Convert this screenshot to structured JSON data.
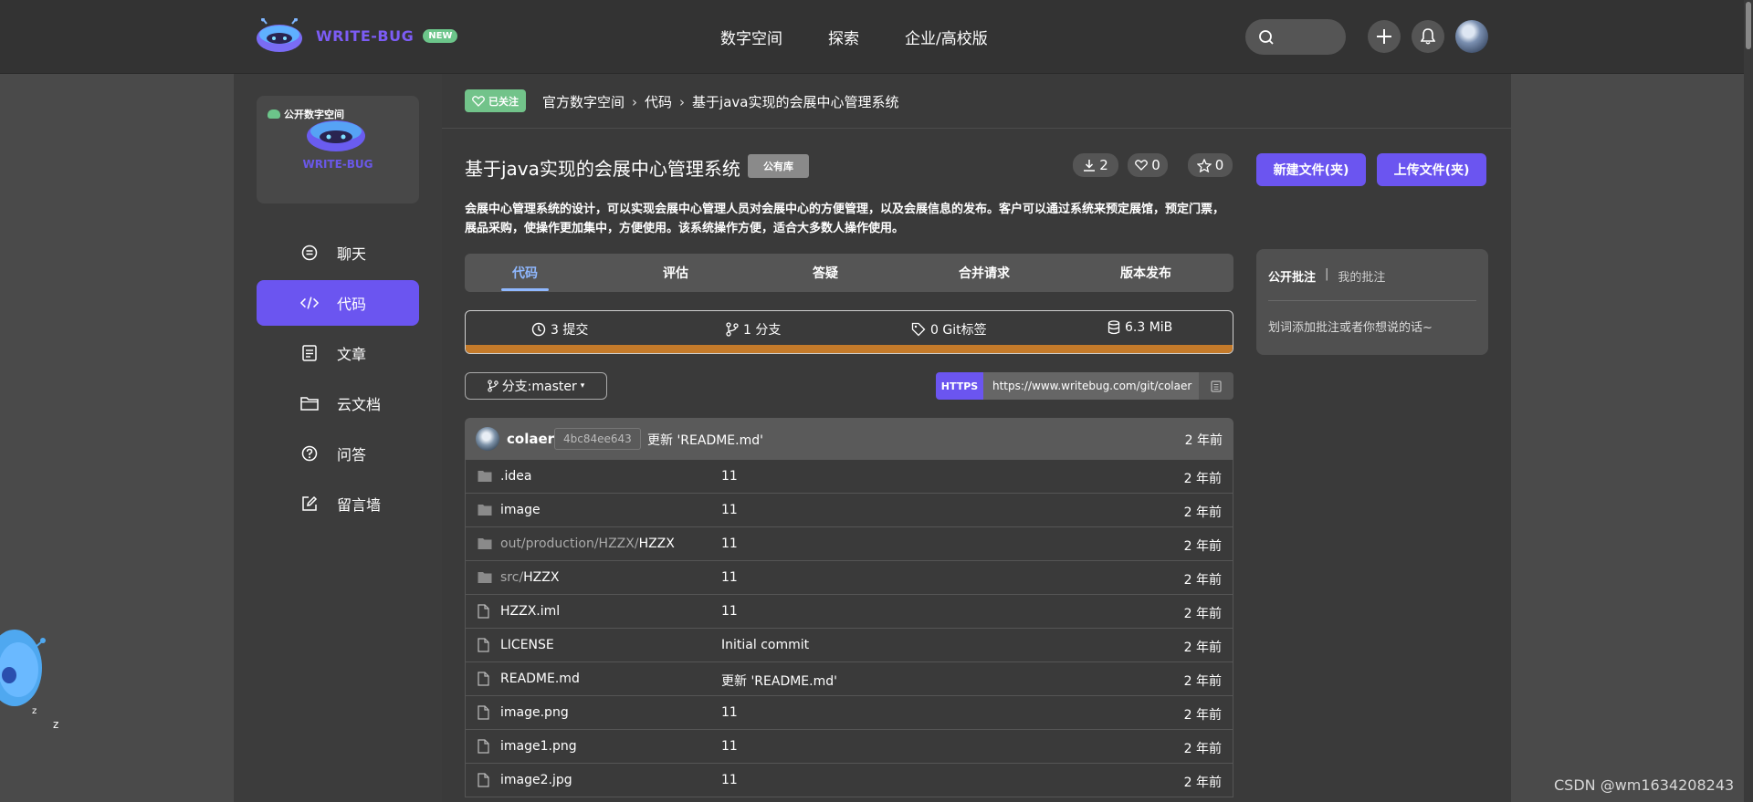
{
  "header": {
    "brand": "WRITE-BUG",
    "new_badge": "NEW",
    "nav": [
      "数字空间",
      "探索",
      "企业/高校版"
    ],
    "icons": {
      "search": "search-icon",
      "add": "plus-icon",
      "notify": "bell-icon"
    },
    "accent_color": "#6b55f0"
  },
  "sidebar": {
    "space_tag": "公开数字空间",
    "space_name": "WRITE-BUG",
    "items": [
      {
        "label": "聊天",
        "icon": "chat-icon",
        "active": false
      },
      {
        "label": "代码",
        "icon": "code-icon",
        "active": true
      },
      {
        "label": "文章",
        "icon": "article-icon",
        "active": false
      },
      {
        "label": "云文档",
        "icon": "folder-icon",
        "active": false
      },
      {
        "label": "问答",
        "icon": "question-icon",
        "active": false
      },
      {
        "label": "留言墙",
        "icon": "edit-icon",
        "active": false
      }
    ]
  },
  "breadcrumb": {
    "followed": "已关注",
    "items": [
      "官方数字空间",
      "代码",
      "基于java实现的会展中心管理系统"
    ]
  },
  "repo": {
    "title": "基于java实现的会展中心管理系统",
    "badge": "公有库",
    "downloads": "2",
    "likes": "0",
    "stars": "0",
    "description": "会展中心管理系统的设计，可以实现会展中心管理人员对会展中心的方便管理，以及会展信息的发布。客户可以通过系统来预定展馆，预定门票，展品采购，使操作更加集中，方便使用。该系统操作方便，适合大多数人操作使用。"
  },
  "tabs": [
    "代码",
    "评估",
    "答疑",
    "合并请求",
    "版本发布"
  ],
  "stats": {
    "commits": "3 提交",
    "branches": "1 分支",
    "tags": "0 Git标签",
    "size": "6.3 MiB"
  },
  "branch_label": "分支:master",
  "clone": {
    "protocol": "HTTPS",
    "url": "https://www.writebug.com/git/colaer"
  },
  "last_commit": {
    "author": "colaer",
    "hash": "4bc84ee643",
    "message": "更新 'README.md'",
    "time": "2 年前"
  },
  "files": [
    {
      "type": "folder",
      "prefix": "",
      "name": ".idea",
      "message": "11",
      "time": "2 年前"
    },
    {
      "type": "folder",
      "prefix": "",
      "name": "image",
      "message": "11",
      "time": "2 年前"
    },
    {
      "type": "folder",
      "prefix": "out/production/HZZX/",
      "name": "HZZX",
      "message": "11",
      "time": "2 年前"
    },
    {
      "type": "folder",
      "prefix": "src/",
      "name": "HZZX",
      "message": "11",
      "time": "2 年前"
    },
    {
      "type": "file",
      "prefix": "",
      "name": "HZZX.iml",
      "message": "11",
      "time": "2 年前"
    },
    {
      "type": "file",
      "prefix": "",
      "name": "LICENSE",
      "message": "Initial commit",
      "time": "2 年前"
    },
    {
      "type": "file",
      "prefix": "",
      "name": "README.md",
      "message": "更新 'README.md'",
      "time": "2 年前"
    },
    {
      "type": "file",
      "prefix": "",
      "name": "image.png",
      "message": "11",
      "time": "2 年前"
    },
    {
      "type": "file",
      "prefix": "",
      "name": "image1.png",
      "message": "11",
      "time": "2 年前"
    },
    {
      "type": "file",
      "prefix": "",
      "name": "image2.jpg",
      "message": "11",
      "time": "2 年前"
    }
  ],
  "actions": {
    "new_file": "新建文件(夹)",
    "upload_file": "上传文件(夹)"
  },
  "comments": {
    "public": "公开批注",
    "divider": "|",
    "mine": "我的批注",
    "hint": "划词添加批注或者你想说的话~"
  },
  "watermark": "CSDN @wm1634208243"
}
